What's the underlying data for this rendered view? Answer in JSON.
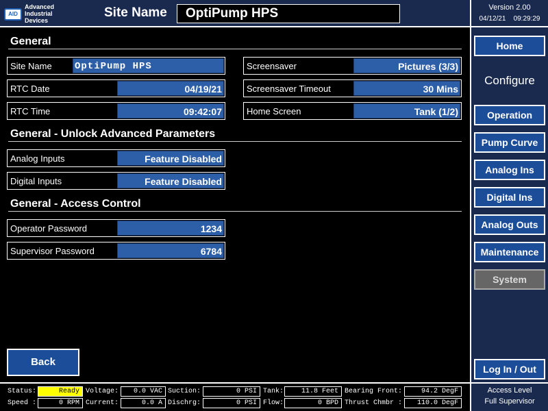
{
  "header": {
    "logo_badge": "AID",
    "logo_line1": "Advanced",
    "logo_line2": "Industrial",
    "logo_line3": "Devices",
    "site_label": "Site Name",
    "site_value": "OptiPump HPS",
    "version": "Version 2.00",
    "date": "04/12/21",
    "time": "09:29:29"
  },
  "sidebar": {
    "home": "Home",
    "configure": "Configure",
    "operation": "Operation",
    "pump_curve": "Pump Curve",
    "analog_ins": "Analog Ins",
    "digital_ins": "Digital Ins",
    "analog_outs": "Analog Outs",
    "maintenance": "Maintenance",
    "system": "System",
    "login": "Log In / Out"
  },
  "general": {
    "title": "General",
    "site_name_label": "Site Name",
    "site_name_value": "OptiPump HPS",
    "rtc_date_label": "RTC Date",
    "rtc_date_value": "04/19/21",
    "rtc_time_label": "RTC Time",
    "rtc_time_value": "09:42:07",
    "screensaver_label": "Screensaver",
    "screensaver_value": "Pictures (3/3)",
    "screensaver_timeout_label": "Screensaver Timeout",
    "screensaver_timeout_value": "30 Mins",
    "home_screen_label": "Home Screen",
    "home_screen_value": "Tank (1/2)"
  },
  "unlock": {
    "title": "General - Unlock Advanced Parameters",
    "analog_label": "Analog Inputs",
    "analog_value": "Feature Disabled",
    "digital_label": "Digital Inputs",
    "digital_value": "Feature Disabled"
  },
  "access_control": {
    "title": "General - Access Control",
    "operator_label": "Operator Password",
    "operator_value": "1234",
    "supervisor_label": "Supervisor Password",
    "supervisor_value": "6784"
  },
  "back_label": "Back",
  "status": {
    "status_label": "Status:",
    "status_value": "Ready",
    "speed_label": "Speed :",
    "speed_value": "0 RPM",
    "voltage_label": "Voltage:",
    "voltage_value": "0.0 VAC",
    "current_label": "Current:",
    "current_value": "0.0 A",
    "suction_label": "Suction:",
    "suction_value": "0 PSI",
    "dischrg_label": "Dischrg:",
    "dischrg_value": "0 PSI",
    "tank_label": "Tank:",
    "tank_value": "11.8 Feet",
    "flow_label": "Flow:",
    "flow_value": "0 BPD",
    "bearing_label": "Bearing Front:",
    "bearing_value": "94.2 DegF",
    "thrust_label": "Thrust Chmbr :",
    "thrust_value": "110.0 DegF"
  },
  "access": {
    "label": "Access Level",
    "value": "Full Supervisor"
  },
  "colors": {
    "panel_bg": "#1a2a4e",
    "value_bg": "#2d5fa8",
    "button_bg": "#1c4d99",
    "ready": "#ffff00"
  }
}
